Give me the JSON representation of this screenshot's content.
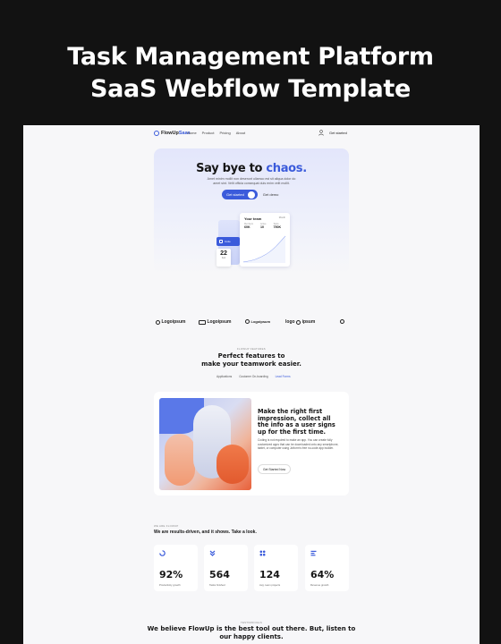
{
  "promo": {
    "line1": "Task Management Platform",
    "line2": "SaaS Webflow Template"
  },
  "nav": {
    "brand_prefix": "FlowUp",
    "brand_suffix": "Saas",
    "links": [
      "Home",
      "Product",
      "Pricing",
      "About"
    ],
    "cta": "Get started"
  },
  "hero": {
    "headline_prefix": "Say bye to ",
    "headline_accent": "chaos.",
    "sub_line1": "Amet minim mollit non deserunt ullamco est sit aliqua dolor do",
    "sub_line2": "amet sint. Velit officia consequat duis enim velit mollit.",
    "primary_btn": "Get started",
    "ghost_btn": "Get demo",
    "mock": {
      "title": "Your team",
      "select": "Month",
      "stats": [
        {
          "label": "Members",
          "value": "60K"
        },
        {
          "label": "Active",
          "value": "10"
        },
        {
          "label": "Tasks",
          "value": "750K"
        }
      ],
      "badge": "Invite",
      "date_num": "22",
      "date_mon": "Feb"
    }
  },
  "logos": [
    "Logoipsum",
    "Logoipsum",
    "Logoipsum",
    "logo",
    "ipsum"
  ],
  "features": {
    "eyebrow": "FLOWUP FEATURES",
    "title_line1": "Perfect features to",
    "title_line2": "make your teamwork easier.",
    "tabs": [
      "Applications",
      "Customer On-boarding",
      "Lead Forms"
    ],
    "card": {
      "headline": "Make the right first impression, collect all the info as a user signs up for the first time.",
      "body": "Coding is not required to make an app. You can create fully customized apps that can be downloaded onto any smartphone, tablet, or computer using Jotform's free no-code app builder.",
      "button": "Get Started Now"
    }
  },
  "results": {
    "eyebrow": "WE ARE FLOWUP",
    "title": "We are results-driven, and it shows. Take a look.",
    "stats": [
      {
        "value": "92%",
        "label": "Productivity growth",
        "icon": "spinner-icon"
      },
      {
        "value": "564",
        "label": "Tasks finished",
        "icon": "chevrons-down-icon"
      },
      {
        "value": "124",
        "label": "Avg. team projects",
        "icon": "grid-icon"
      },
      {
        "value": "64%",
        "label": "Revenue growth",
        "icon": "lines-icon"
      }
    ]
  },
  "testimonials": {
    "eyebrow": "TESTIMONIALS",
    "title_line1": "We believe FlowUp is the best tool out there. But, listen to",
    "title_line2": "our happy clients."
  },
  "colors": {
    "accent": "#3b5bdb",
    "orange": "#e8603a",
    "background": "#121212"
  }
}
